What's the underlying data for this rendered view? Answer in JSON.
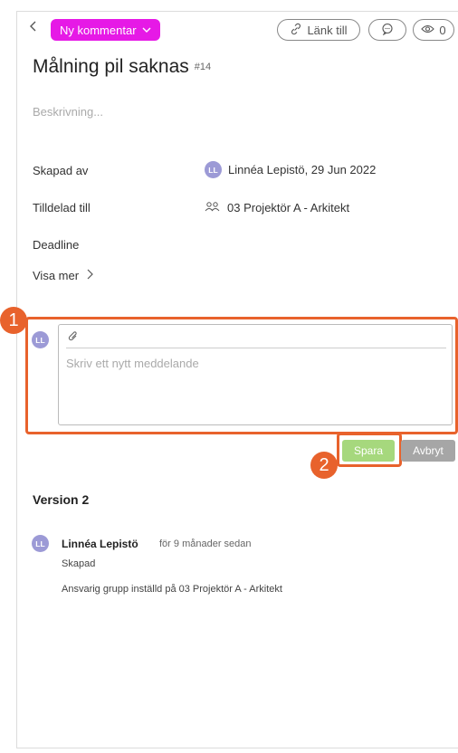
{
  "header": {
    "back_icon": "chevron-left-icon",
    "tag_label": "Ny kommentar",
    "link_label": "Länk till",
    "watchers_count": "0",
    "colors": {
      "tag": "#e619e6",
      "highlight": "#e8622c",
      "save": "#a6d87d",
      "cancel": "#a6a6a6"
    }
  },
  "issue": {
    "title": "Målning pil saknas",
    "number": "#14",
    "description_placeholder": "Beskrivning..."
  },
  "details": {
    "created_by_label": "Skapad av",
    "created_by_initials": "LL",
    "created_by_value": "Linnéa Lepistö, 29 Jun 2022",
    "assigned_label": "Tilldelad till",
    "assigned_value": "03 Projektör A - Arkitekt",
    "deadline_label": "Deadline",
    "show_more": "Visa mer"
  },
  "comment": {
    "initials": "LL",
    "placeholder": "Skriv ett nytt meddelande",
    "save": "Spara",
    "cancel": "Avbryt"
  },
  "markers": [
    "1",
    "2"
  ],
  "history": {
    "title": "Version 2",
    "initials": "LL",
    "author": "Linnéa Lepistö",
    "time": "för 9 månader sedan",
    "line1": "Skapad",
    "line2": "Ansvarig grupp inställd på 03 Projektör A - Arkitekt"
  }
}
